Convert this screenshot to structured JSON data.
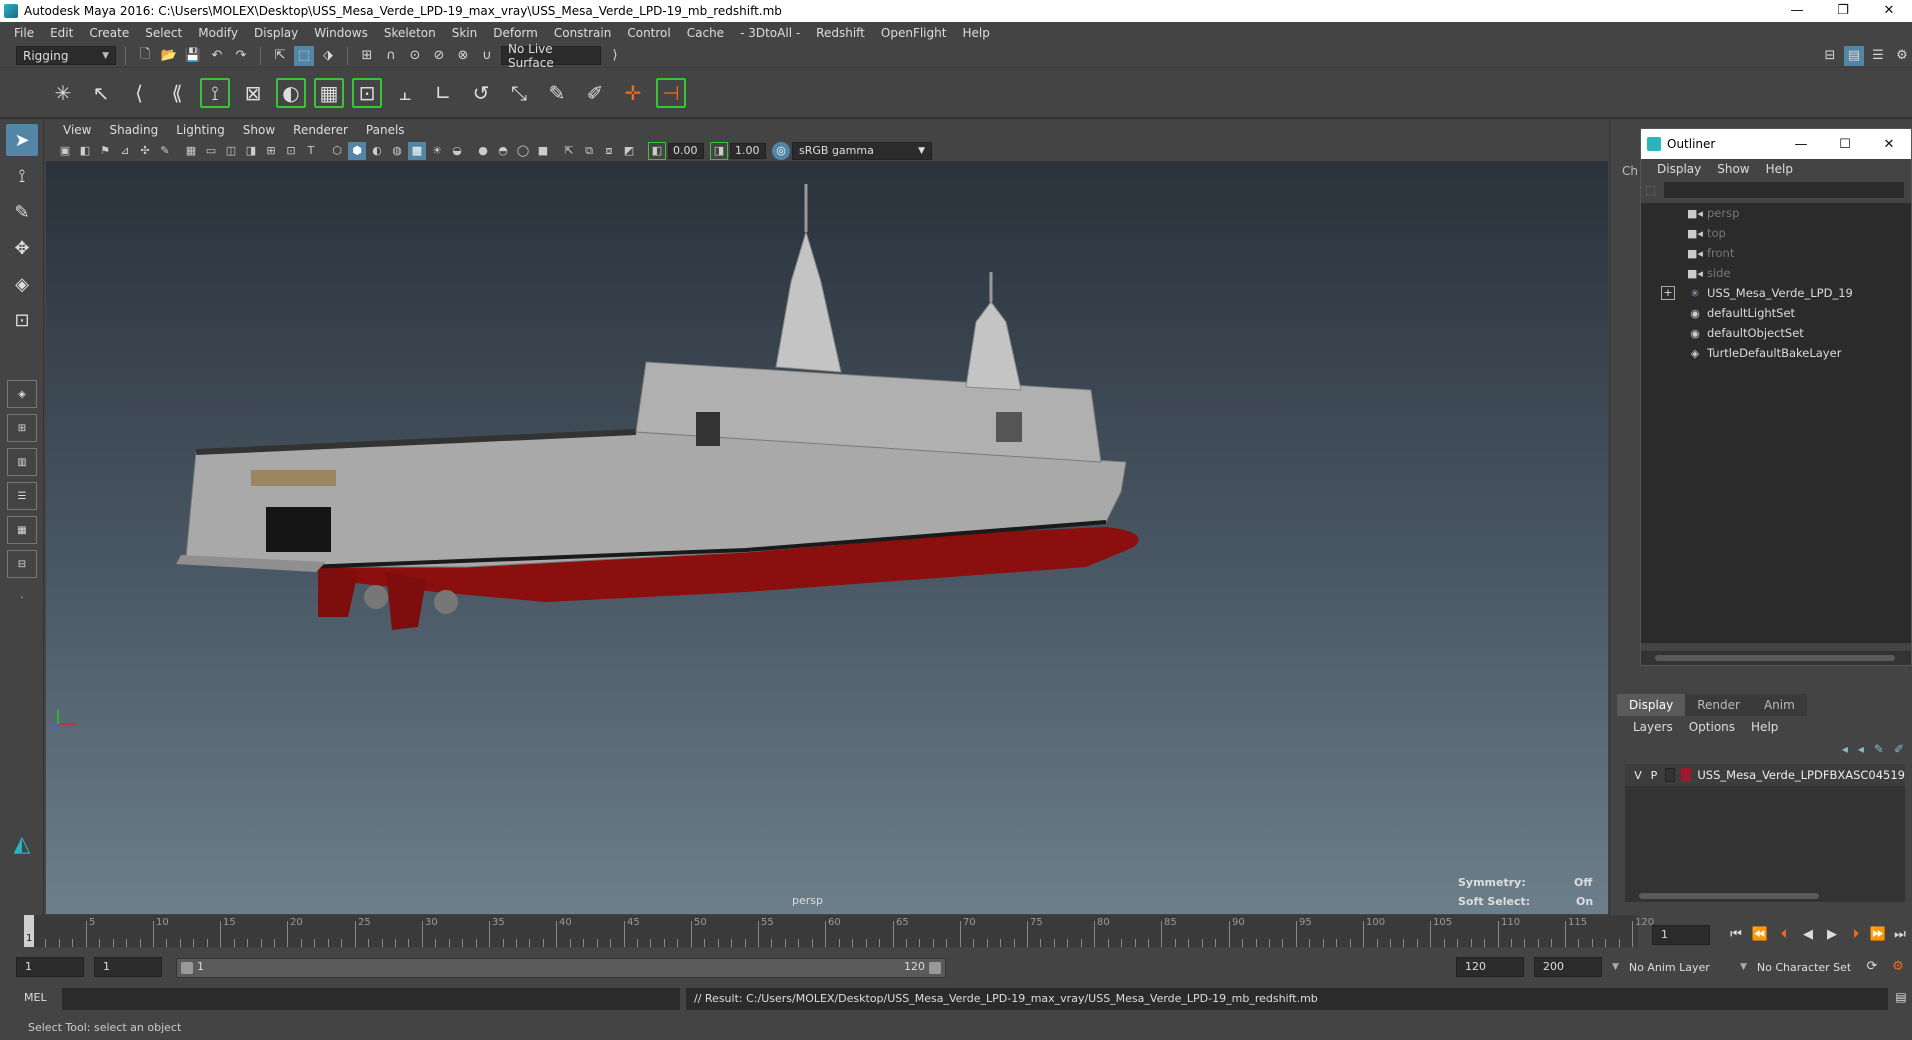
{
  "window": {
    "title": "Autodesk Maya 2016: C:\\Users\\MOLEX\\Desktop\\USS_Mesa_Verde_LPD-19_max_vray\\USS_Mesa_Verde_LPD-19_mb_redshift.mb",
    "controls": {
      "minimize": "—",
      "restore": "❐",
      "close": "✕"
    }
  },
  "menubar": [
    "File",
    "Edit",
    "Create",
    "Select",
    "Modify",
    "Display",
    "Windows",
    "Skeleton",
    "Skin",
    "Deform",
    "Constrain",
    "Control",
    "Cache",
    "- 3DtoAll -",
    "Redshift",
    "OpenFlight",
    "Help"
  ],
  "statusline": {
    "menuset": "Rigging",
    "live_surface": "No Live Surface"
  },
  "panel": {
    "menus": [
      "View",
      "Shading",
      "Lighting",
      "Show",
      "Renderer",
      "Panels"
    ],
    "exposure": "0.00",
    "gamma": "1.00",
    "color_space": "sRGB gamma"
  },
  "viewport": {
    "camera_label": "persp",
    "hud": {
      "symmetry_label": "Symmetry:",
      "symmetry_value": "Off",
      "soft_select_label": "Soft Select:",
      "soft_select_value": "On"
    },
    "colors": {
      "hull_grey": "#a9a9a9",
      "hull_red": "#8b0f0f",
      "background_top": "#2a323b",
      "background_bottom": "#6c7f8a"
    }
  },
  "outliner": {
    "title": "Outliner",
    "menus": [
      "Display",
      "Show",
      "Help"
    ],
    "dock_label": "Ch",
    "nodes": [
      {
        "label": "persp",
        "icon": "camera-icon",
        "dim": true
      },
      {
        "label": "top",
        "icon": "camera-icon",
        "dim": true
      },
      {
        "label": "front",
        "icon": "camera-icon",
        "dim": true
      },
      {
        "label": "side",
        "icon": "camera-icon",
        "dim": true
      },
      {
        "label": "USS_Mesa_Verde_LPD_19",
        "icon": "group-icon",
        "dim": false,
        "expand": "+"
      },
      {
        "label": "defaultLightSet",
        "icon": "set-icon",
        "dim": false
      },
      {
        "label": "defaultObjectSet",
        "icon": "set-icon",
        "dim": false
      },
      {
        "label": "TurtleDefaultBakeLayer",
        "icon": "bake-layer-icon",
        "dim": false
      }
    ]
  },
  "layer_editor": {
    "tabs": [
      "Display",
      "Render",
      "Anim"
    ],
    "menus": [
      "Layers",
      "Options",
      "Help"
    ],
    "layers": [
      {
        "v": "V",
        "p": "P",
        "name": "USS_Mesa_Verde_LPDFBXASC04519",
        "color": "#a0182e"
      }
    ]
  },
  "timeline": {
    "ticks": [
      "5",
      "10",
      "15",
      "20",
      "25",
      "30",
      "35",
      "40",
      "45",
      "50",
      "55",
      "60",
      "65",
      "70",
      "75",
      "80",
      "85",
      "90",
      "95",
      "100",
      "105",
      "110",
      "115",
      "120"
    ],
    "current_frame_marker": "1",
    "current_frame": "1"
  },
  "range": {
    "start": "1",
    "anim_start": "1",
    "range_start": "1",
    "range_end": "120",
    "anim_end_field": "120",
    "playback_end": "200",
    "anim_layer": "No Anim Layer",
    "character_set": "No Character Set"
  },
  "command": {
    "language": "MEL",
    "result": "// Result: C:/Users/MOLEX/Desktop/USS_Mesa_Verde_LPD-19_max_vray/USS_Mesa_Verde_LPD-19_mb_redshift.mb"
  },
  "helpline": "Select Tool: select an object"
}
